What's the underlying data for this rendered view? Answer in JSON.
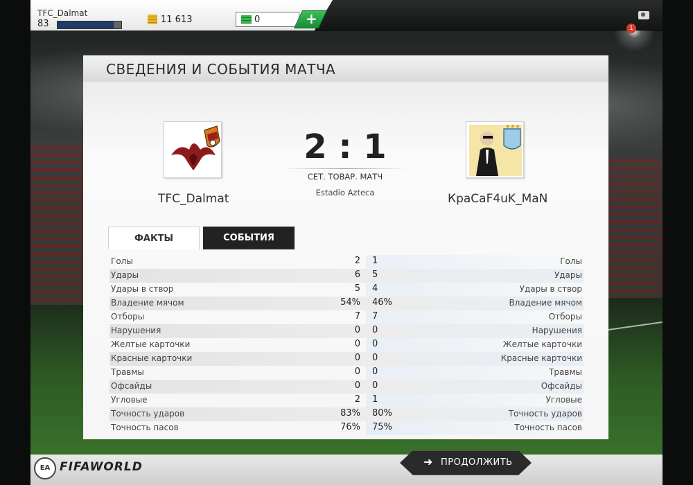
{
  "header": {
    "player_name": "TFC_Dalmat",
    "level": "83",
    "xp_fraction": 0.88,
    "coins": "11 613",
    "cash": "0",
    "add_icon": "plus-icon",
    "notification_count": "1"
  },
  "panel": {
    "title": "СВЕДЕНИЯ И СОБЫТИЯ МАТЧА",
    "home_team": "TFC_Dalmat",
    "away_team": "КраСaF4uK_MaN",
    "score": "2 : 1",
    "match_type": "СЕТ. ТОВАР. МАТЧ",
    "stadium": "Estadio Azteca"
  },
  "tabs": [
    {
      "label": "ФАКТЫ",
      "active": true
    },
    {
      "label": "СОБЫТИЯ",
      "active": false
    }
  ],
  "stats": [
    {
      "label": "Голы",
      "home": "2",
      "away": "1"
    },
    {
      "label": "Удары",
      "home": "6",
      "away": "5"
    },
    {
      "label": "Удары в створ",
      "home": "5",
      "away": "4"
    },
    {
      "label": "Владение мячом",
      "home": "54%",
      "away": "46%"
    },
    {
      "label": "Отборы",
      "home": "7",
      "away": "7"
    },
    {
      "label": "Нарушения",
      "home": "0",
      "away": "0"
    },
    {
      "label": "Желтые карточки",
      "home": "0",
      "away": "0"
    },
    {
      "label": "Красные карточки",
      "home": "0",
      "away": "0"
    },
    {
      "label": "Травмы",
      "home": "0",
      "away": "0"
    },
    {
      "label": "Офсайды",
      "home": "0",
      "away": "0"
    },
    {
      "label": "Угловые",
      "home": "2",
      "away": "1"
    },
    {
      "label": "Точность ударов",
      "home": "83%",
      "away": "80%"
    },
    {
      "label": "Точность пасов",
      "home": "76%",
      "away": "75%"
    }
  ],
  "footer": {
    "brand": "FIFAWORLD",
    "ea_logo": "EA",
    "continue_label": "ПРОДОЛЖИТЬ",
    "continue_icon": "arrow-right-icon"
  },
  "colors": {
    "accent_green": "#1a8a35",
    "dark_tab": "#222222",
    "xp_fill": "#1f3b66"
  }
}
